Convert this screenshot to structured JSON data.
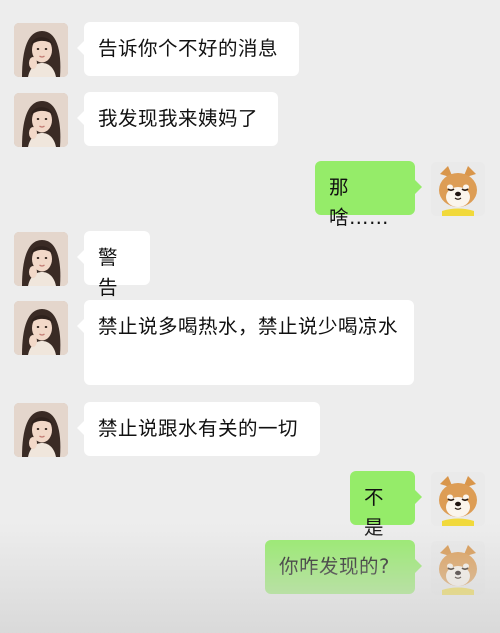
{
  "messages": [
    {
      "side": "left",
      "text": "告诉你个不好的消息"
    },
    {
      "side": "left",
      "text": "我发现我来姨妈了"
    },
    {
      "side": "right",
      "text": "那啥……"
    },
    {
      "side": "left",
      "text": "警告"
    },
    {
      "side": "left",
      "text": "禁止说多喝热水，禁止说少喝凉水"
    },
    {
      "side": "left",
      "text": "禁止说跟水有关的一切"
    },
    {
      "side": "right",
      "text": "不是"
    },
    {
      "side": "right",
      "text": "你咋发现的?"
    }
  ],
  "colors": {
    "background": "#ededed",
    "incoming_bubble": "#ffffff",
    "outgoing_bubble": "#95ec69"
  },
  "avatars": {
    "incoming": "girl-photo-avatar",
    "outgoing": "shiba-inu-dog-avatar"
  }
}
